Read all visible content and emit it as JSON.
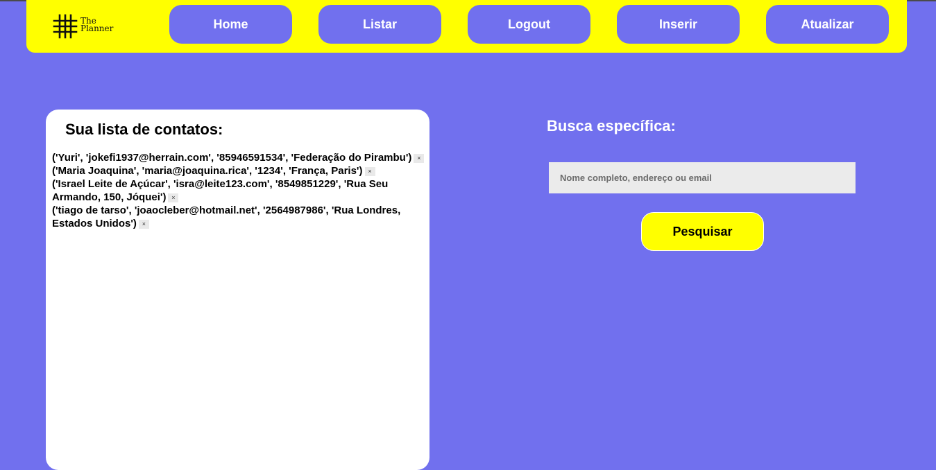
{
  "brand": {
    "line1": "The",
    "line2": "Planner",
    "icon": "hashtag-grid-icon"
  },
  "nav": {
    "home": "Home",
    "list": "Listar",
    "logout": "Logout",
    "insert": "Inserir",
    "update": "Atualizar"
  },
  "contacts": {
    "title": "Sua lista de contatos:",
    "delete_symbol": "×",
    "items": [
      "('Yuri', 'jokefi1937@herrain.com', '85946591534', 'Federação do Pirambu')",
      "('Maria Joaquina', 'maria@joaquina.rica', '1234', 'França, Paris')",
      "('Israel Leite de Açúcar', 'isra@leite123.com', '8549851229', 'Rua Seu Armando, 150, Jóquei')",
      "('tiago de tarso', 'joaocleber@hotmail.net', '2564987986', 'Rua Londres, Estados Unidos')"
    ]
  },
  "search": {
    "title": "Busca específica:",
    "placeholder": "Nome completo, endereço ou email",
    "value": "",
    "button": "Pesquisar"
  },
  "colors": {
    "background": "#7170ee",
    "navbar": "#ffff00",
    "nav_button": "#7170ee",
    "search_button": "#ffff00",
    "card": "#ffffff"
  }
}
